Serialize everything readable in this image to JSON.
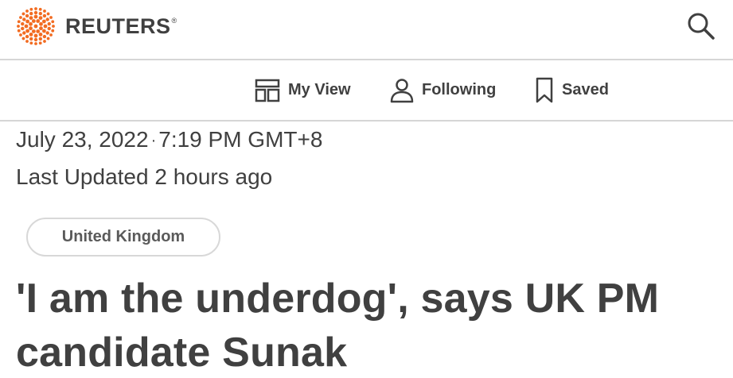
{
  "header": {
    "brand": "REUTERS",
    "registered_mark": "®",
    "logo_icon": "reuters-dots-logo",
    "logo_color": "#f26c22",
    "search_icon": "search-icon"
  },
  "subnav": {
    "items": [
      {
        "label": "My View",
        "icon": "layout-icon"
      },
      {
        "label": "Following",
        "icon": "person-icon"
      },
      {
        "label": "Saved",
        "icon": "bookmark-icon"
      }
    ]
  },
  "article": {
    "date": "July 23, 2022",
    "separator": "·",
    "time": "7:19 PM GMT+8",
    "updated": "Last Updated 2 hours ago",
    "topic": "United Kingdom",
    "headline": "'I am the underdog', says UK PM candidate Sunak"
  }
}
